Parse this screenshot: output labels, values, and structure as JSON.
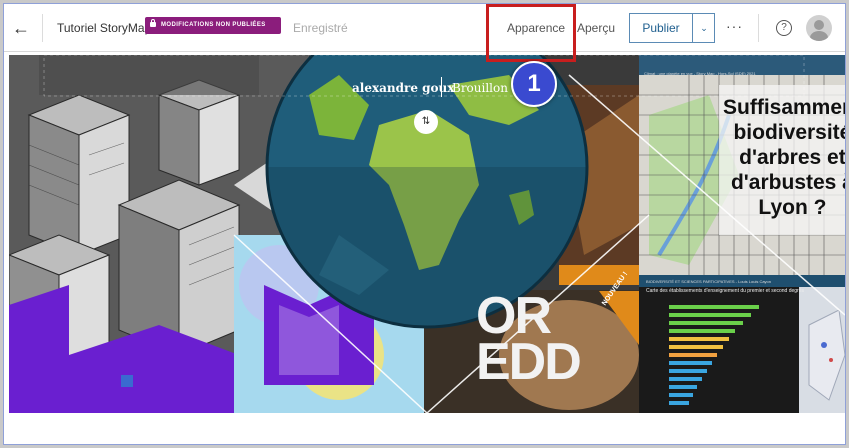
{
  "topbar": {
    "title": "Tutoriel StoryMap",
    "badge": "MODIFICATIONS NON PUBLIÉES",
    "saved": "Enregistré",
    "apparence": "Apparence",
    "apercu": "Aperçu",
    "publish": "Publier",
    "more": "···",
    "help": "?"
  },
  "annotation": {
    "step": "1"
  },
  "cover": {
    "author": "alexandre goux",
    "status": "Brouillon",
    "swap": "⇅",
    "tiles": {
      "biodiversity": "Suffisamment\nbiodiversité\nd'arbres et\nd'arbustes à\nLyon ?",
      "ordd": "OR\nEDD",
      "nouveau": "NOUVEAU !",
      "chart_title": "Carte des établissements d'enseignement du premier et second degrés",
      "map_caption": "Climat : une planète en vue - Story Map - Hors-Sol (SDE) 2021",
      "bio_caption": "BIODIVERSITÉ ET SCIENCES PARTICIPATIVES - Louis Louis Cayon"
    }
  },
  "colors": {
    "accent": "#8b1d7c",
    "highlight": "#c81e1e",
    "step": "#3a4ad0",
    "publish": "#1f5f8f"
  }
}
